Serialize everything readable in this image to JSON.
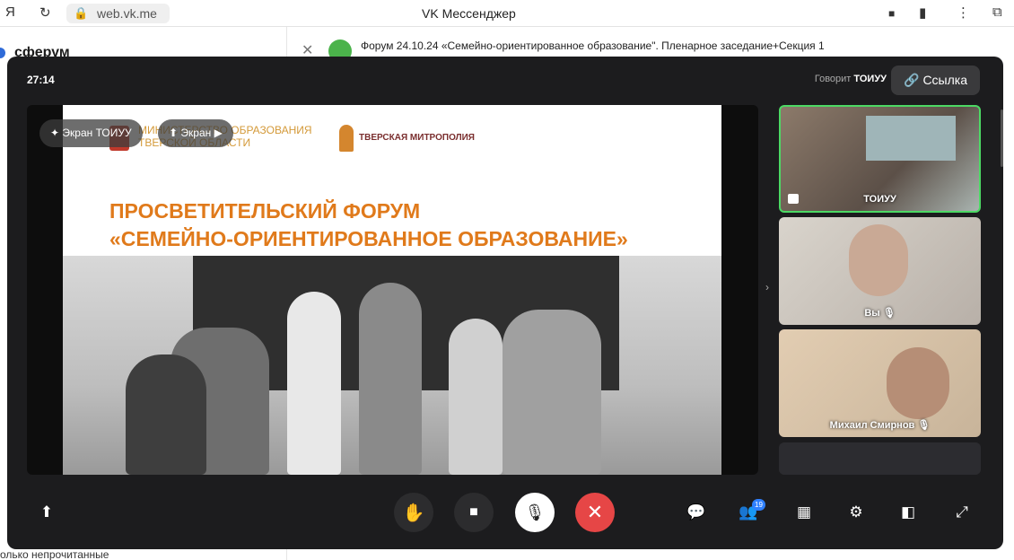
{
  "browser": {
    "yandex_icon": "Я",
    "url": "web.vk.me",
    "tab_title": "VK Мессенджер"
  },
  "background": {
    "logo": "сферум",
    "chat_title": "Форум 24.10.24 «Семейно-ориентированное образование\". Пленарное заседание+Секция 1",
    "bottom_text": "олько непрочитанные"
  },
  "call": {
    "timer": "27:14",
    "speaking_label": "Говорит",
    "speaking_name": "ТОИУУ",
    "link_label": "Ссылка",
    "chip_screen_owner": "Экран ТОИУУ",
    "chip_screen": "Экран",
    "slide": {
      "logo1_line1": "МИНИСТЕРСТВО ОБРАЗОВАНИЯ",
      "logo1_line2": "ТВЕРСКОЙ ОБЛАСТИ",
      "logo2": "ТВЕРСКАЯ МИТРОПОЛИЯ",
      "title_line1": "ПРОСВЕТИТЕЛЬСКИЙ ФОРУМ",
      "title_line2": "«СЕМЕЙНО-ОРИЕНТИРОВАННОЕ ОБРАЗОВАНИЕ»"
    },
    "participants": [
      {
        "name": "ТОИУУ"
      },
      {
        "name": "Вы"
      },
      {
        "name": "Михаил Смирнов"
      }
    ],
    "participants_count": "19"
  },
  "colors": {
    "call_bg": "#1c1c1e",
    "active_border": "#4cd964",
    "end_call": "#e64646",
    "slide_title": "#e07a1b"
  }
}
